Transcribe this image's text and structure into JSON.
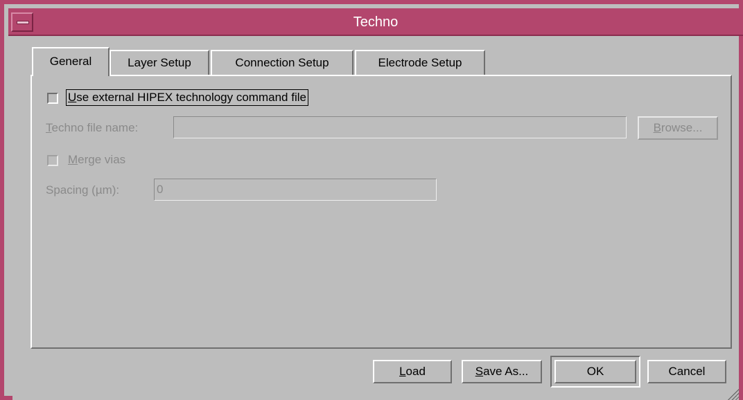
{
  "window": {
    "title": "Techno"
  },
  "tabs": [
    {
      "label": "General",
      "active": true
    },
    {
      "label": "Layer Setup",
      "active": false
    },
    {
      "label": "Connection Setup",
      "active": false
    },
    {
      "label": "Electrode Setup",
      "active": false
    }
  ],
  "general": {
    "use_external": {
      "mnemonic": "U",
      "rest": "se external HIPEX technology command file",
      "checked": false
    },
    "techno_file": {
      "mnemonic": "T",
      "rest": "echno file name:",
      "value": ""
    },
    "browse": {
      "mnemonic": "B",
      "rest": "rowse..."
    },
    "merge_vias": {
      "mnemonic": "M",
      "rest": "erge vias",
      "checked": false
    },
    "spacing": {
      "label": "Spacing (µm):",
      "value": "0"
    }
  },
  "buttons": {
    "load": {
      "mnemonic": "L",
      "rest": "oad"
    },
    "save_as": {
      "mnemonic": "S",
      "rest": "ave As..."
    },
    "ok": "OK",
    "cancel": "Cancel"
  },
  "colors": {
    "titlebar": "#b3466d",
    "background": "#bdbdbd",
    "disabled_text": "#8a8a8a"
  }
}
